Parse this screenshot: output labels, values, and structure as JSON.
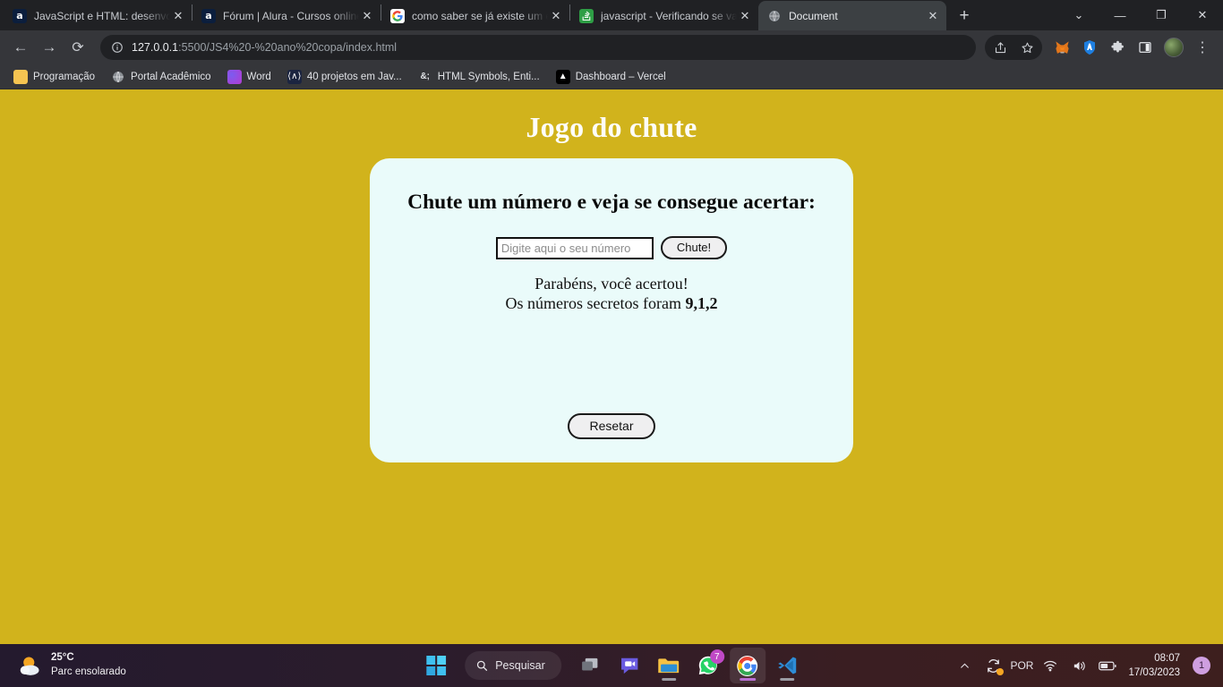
{
  "browser": {
    "tabs": [
      {
        "title": "JavaScript e HTML: desenvolv",
        "favicon": "alura-icon",
        "active": false
      },
      {
        "title": "Fórum | Alura - Cursos online",
        "favicon": "alura-icon",
        "active": false
      },
      {
        "title": "como saber se já existe um e",
        "favicon": "google-icon",
        "active": false
      },
      {
        "title": "javascript - Verificando se val",
        "favicon": "stackoverflow-icon",
        "active": false
      },
      {
        "title": "Document",
        "favicon": "globe-icon",
        "active": true
      }
    ],
    "new_tab_label": "+",
    "window_controls": {
      "chevron": "⌄",
      "minimize": "—",
      "maximize": "❐",
      "close": "✕"
    },
    "nav": {
      "back": "←",
      "forward": "→",
      "reload": "⟳"
    },
    "omnibox": {
      "info_icon": "info-circle-icon",
      "url_host": "127.0.0.1",
      "url_rest": ":5500/JS4%20-%20ano%20copa/index.html",
      "full_url": "127.0.0.1:5500/JS4%20-%20ano%20copa/index.html"
    },
    "toolbar_right": {
      "share": "share-icon",
      "bookmark": "star-icon",
      "metamask": "metamask-fox-icon",
      "adblock": "adblock-shield-icon",
      "extensions": "puzzle-icon",
      "sidebar": "sidebar-panel-icon",
      "profile": "profile-avatar",
      "menu": "three-dot-menu-icon"
    },
    "bookmarks": [
      {
        "label": "Programação",
        "icon": "folder-icon"
      },
      {
        "label": "Portal Acadêmico",
        "icon": "globe-icon"
      },
      {
        "label": "Word",
        "icon": "word-icon"
      },
      {
        "label": "40 projetos em Jav...",
        "icon": "project-icon"
      },
      {
        "label": "HTML Symbols, Enti...",
        "icon": "ampersand-icon"
      },
      {
        "label": "Dashboard – Vercel",
        "icon": "vercel-icon"
      }
    ]
  },
  "page": {
    "title": "Jogo do chute",
    "heading": "Chute um número e veja se consegue acertar:",
    "input": {
      "value": "",
      "placeholder": "Digite aqui o seu número"
    },
    "guess_button": "Chute!",
    "result_line1": "Parabéns, você acertou!",
    "result_line2_prefix": "Os números secretos foram ",
    "secret_numbers": "9,1,2",
    "reset_button": "Resetar",
    "colors": {
      "background": "#d1b31c",
      "card": "#eafbfa",
      "title": "#fdfdfa",
      "text": "#111111"
    }
  },
  "taskbar": {
    "weather": {
      "temperature": "25°C",
      "condition": "Parc ensolarado",
      "icon": "sun-cloud-icon"
    },
    "start": "windows-start-icon",
    "search_placeholder": "Pesquisar",
    "items": [
      {
        "name": "task-view-icon",
        "badge": ""
      },
      {
        "name": "teams-chat-icon",
        "badge": ""
      },
      {
        "name": "file-explorer-icon",
        "badge": ""
      },
      {
        "name": "whatsapp-icon",
        "badge": "7"
      },
      {
        "name": "chrome-icon",
        "badge": ""
      },
      {
        "name": "vscode-icon",
        "badge": ""
      }
    ],
    "tray": {
      "overflow": "chevron-up-icon",
      "update": "sync-update-icon",
      "language": "POR",
      "wifi": "wifi-icon",
      "volume": "volume-icon",
      "battery": "battery-icon",
      "time": "08:07",
      "date": "17/03/2023",
      "notification_count": "1"
    }
  }
}
